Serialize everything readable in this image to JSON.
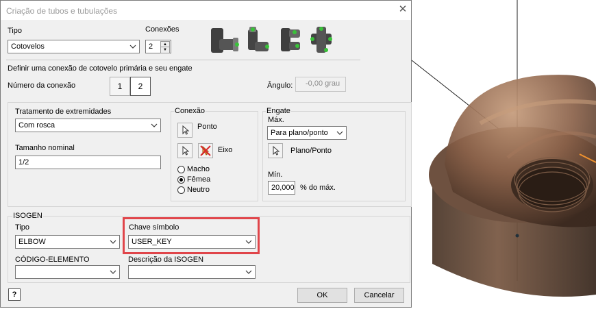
{
  "dialog": {
    "title": "Criação de tubos e tubulações",
    "tipo_label": "Tipo",
    "tipo_value": "Cotovelos",
    "conexoes_label": "Conexões",
    "conexoes_value": "2",
    "section_heading": "Definir uma conexão de cotovelo primária e seu engate",
    "numero_label": "Número da conexão",
    "numero_buttons": [
      "1",
      "2"
    ],
    "angulo_label": "Ângulo:",
    "angulo_value": "-0,00 grau",
    "tratamento_label": "Tratamento de extremidades",
    "tratamento_value": "Com rosca",
    "tamanho_label": "Tamanho nominal",
    "tamanho_value": "1/2",
    "conexao_group": "Conexão",
    "ponto_label": "Ponto",
    "eixo_label": "Eixo",
    "radios": [
      "Macho",
      "Fêmea",
      "Neutro"
    ],
    "radio_selected": "Fêmea",
    "engate_group": "Engate",
    "max_label": "Máx.",
    "max_value": "Para plano/ponto",
    "plano_ponto_label": "Plano/Ponto",
    "min_label": "Mín.",
    "min_value": "20,000",
    "min_unit": "% do máx.",
    "isogen_label": "ISOGEN",
    "isogen_tipo_label": "Tipo",
    "isogen_tipo_value": "ELBOW",
    "chave_label": "Chave símbolo",
    "chave_value": "USER_KEY",
    "codigo_label": "CÓDIGO-ELEMENTO",
    "codigo_value": "",
    "descricao_label": "Descrição da ISOGEN",
    "descricao_value": "",
    "ok_label": "OK",
    "cancel_label": "Cancelar"
  },
  "colors": {
    "highlight": "#e0454a",
    "fitting_metal": "#4a4a4a",
    "fitting_nub": "#39c239",
    "model_bronze": "#6b4a36"
  },
  "icons": [
    "close-icon",
    "help-icon",
    "cursor-icon",
    "cancel-selection-icon",
    "spin-up-icon",
    "spin-down-icon",
    "chevron-down-icon"
  ]
}
